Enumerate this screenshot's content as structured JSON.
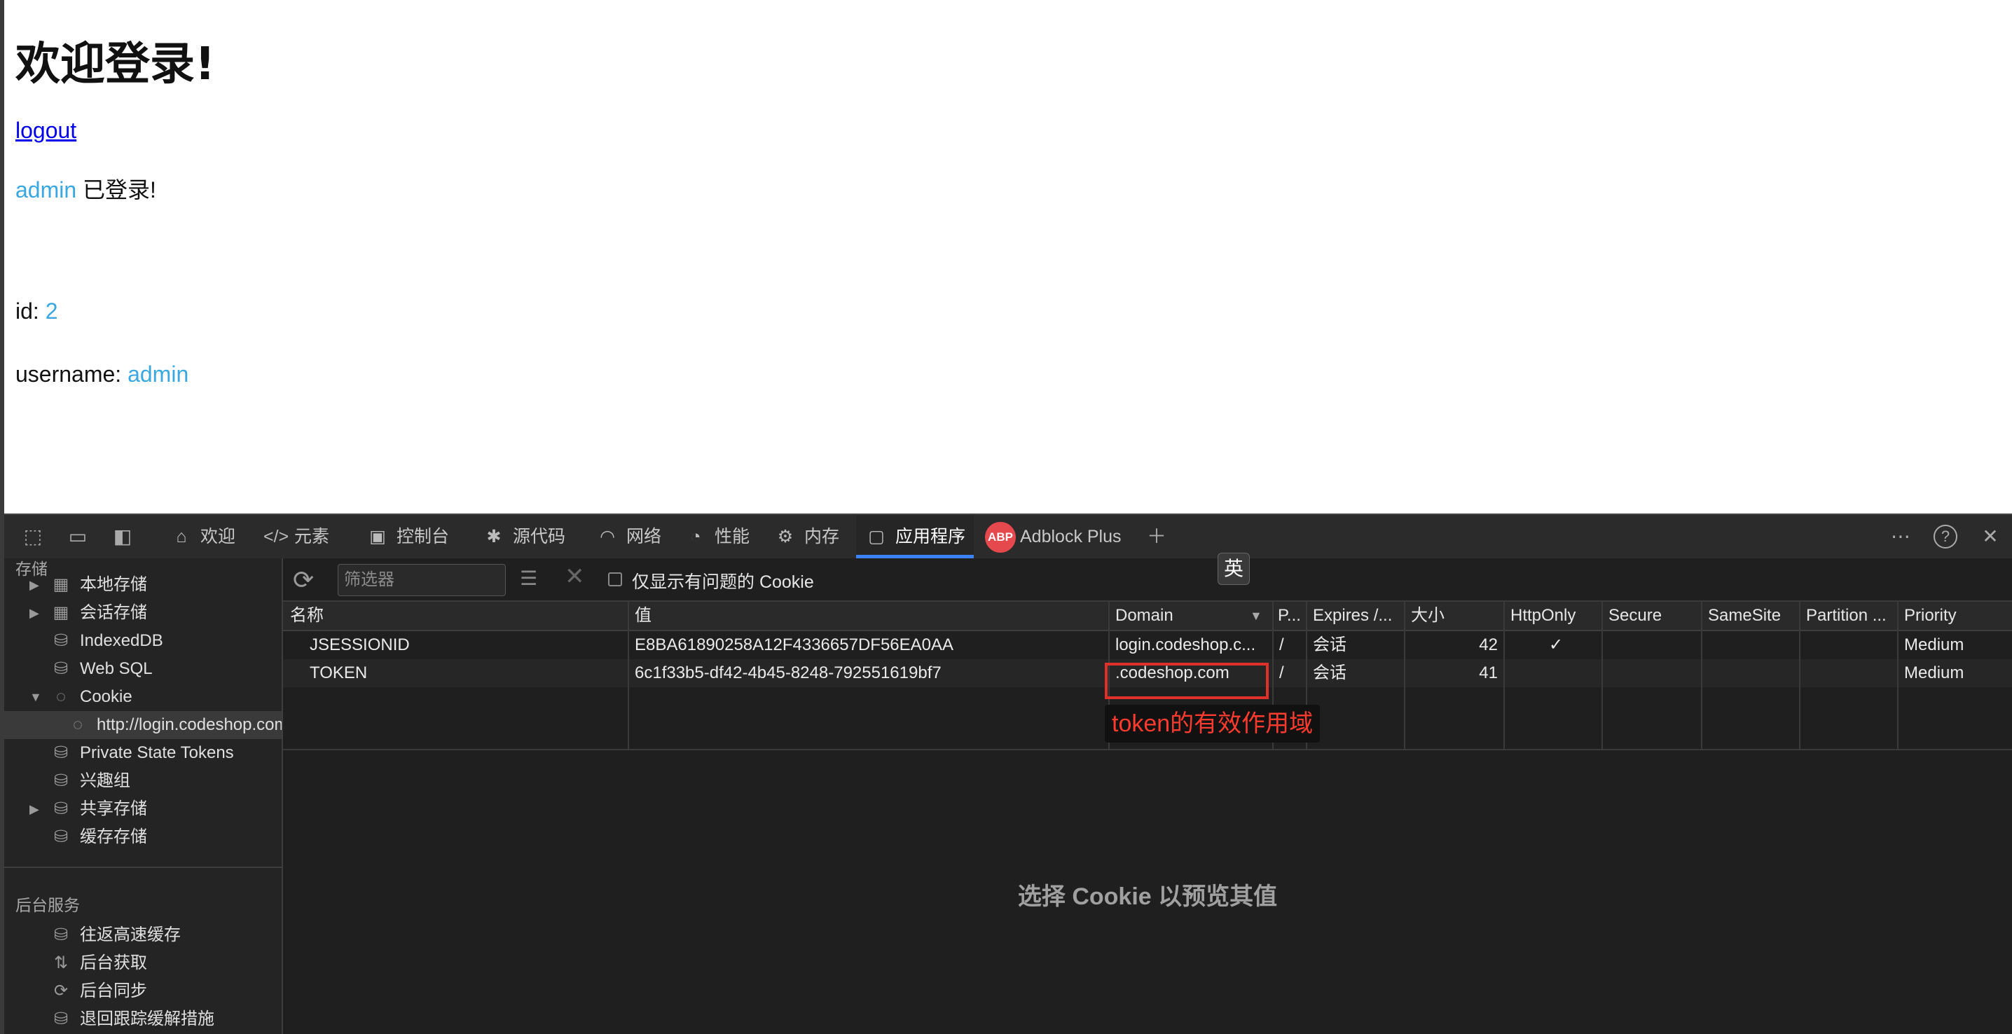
{
  "page": {
    "heading": "欢迎登录!",
    "logout_link": "logout",
    "login_user": "admin",
    "login_suffix": " 已登录!",
    "id_label": "id: ",
    "id_value": "2",
    "username_label": "username: ",
    "username_value": "admin"
  },
  "devtools": {
    "tabs": [
      {
        "label": "欢迎",
        "icon": "home-icon"
      },
      {
        "label": "元素",
        "icon": "code-icon"
      },
      {
        "label": "控制台",
        "icon": "console-icon"
      },
      {
        "label": "源代码",
        "icon": "bug-icon"
      },
      {
        "label": "网络",
        "icon": "wifi-icon"
      },
      {
        "label": "性能",
        "icon": "gauge-icon"
      },
      {
        "label": "内存",
        "icon": "chip-icon"
      },
      {
        "label": "应用程序",
        "icon": "app-window-icon"
      },
      {
        "label": "Adblock Plus",
        "icon": "abp-icon"
      }
    ],
    "abp_badge": "ABP",
    "ime_indicator": "英",
    "sidebar": {
      "storage_header": "存储",
      "items": [
        {
          "label": "本地存储"
        },
        {
          "label": "会话存储"
        },
        {
          "label": "IndexedDB"
        },
        {
          "label": "Web SQL"
        },
        {
          "label": "Cookie"
        },
        {
          "label": "http://login.codeshop.com"
        },
        {
          "label": "Private State Tokens"
        },
        {
          "label": "兴趣组"
        },
        {
          "label": "共享存储"
        },
        {
          "label": "缓存存储"
        }
      ],
      "background_header": "后台服务",
      "bg_items": [
        {
          "label": "往返高速缓存"
        },
        {
          "label": "后台获取"
        },
        {
          "label": "后台同步"
        },
        {
          "label": "退回跟踪缓解措施"
        }
      ]
    },
    "filter": {
      "placeholder": "筛选器",
      "only_issues_label": "仅显示有问题的 Cookie"
    },
    "columns": [
      "名称",
      "值",
      "Domain",
      "P...",
      "Expires /...",
      "大小",
      "HttpOnly",
      "Secure",
      "SameSite",
      "Partition ...",
      "Priority"
    ],
    "rows": [
      {
        "name": "JSESSIONID",
        "value": "E8BA61890258A12F4336657DF56EA0AA",
        "domain": "login.codeshop.c...",
        "path": "/",
        "expires": "会话",
        "size": "42",
        "httponly": "✓",
        "secure": "",
        "samesite": "",
        "partition": "",
        "priority": "Medium"
      },
      {
        "name": "TOKEN",
        "value": "6c1f33b5-df42-4b45-8248-792551619bf7",
        "domain": ".codeshop.com",
        "path": "/",
        "expires": "会话",
        "size": "41",
        "httponly": "",
        "secure": "",
        "samesite": "",
        "partition": "",
        "priority": "Medium"
      }
    ],
    "annotation": "token的有效作用域",
    "preview_text": "选择 Cookie 以预览其值",
    "colors": {
      "accent": "#3b82f6",
      "annotation": "#e0302a",
      "link": "#3aa7e0"
    }
  }
}
